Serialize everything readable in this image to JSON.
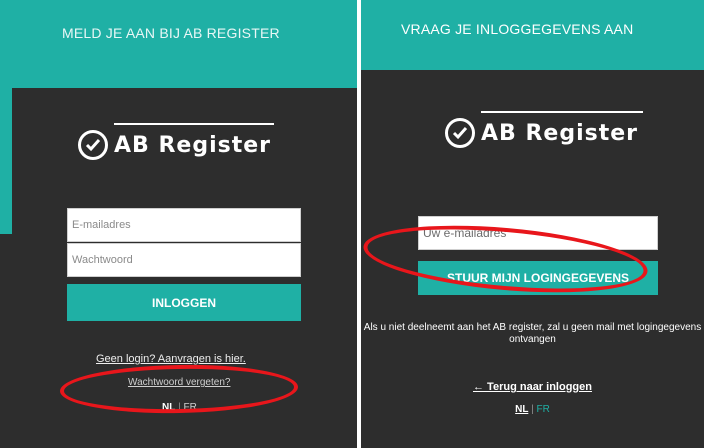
{
  "left_panel": {
    "header": "MELD JE AAN BIJ AB REGISTER",
    "logo_text": "AB Register",
    "email_placeholder": "E-mailadres",
    "password_placeholder": "Wachtwoord",
    "login_button": "INLOGGEN",
    "no_login_text": "Geen login? Aanvragen is hier.",
    "forgot_link": "Wachtwoord vergeten?",
    "lang_nl": "NL",
    "lang_sep": "|",
    "lang_fr": "FR"
  },
  "right_panel": {
    "header": "VRAAG JE INLOGGEGEVENS AAN",
    "logo_text": "AB Register",
    "email_placeholder": "Uw e-mailadres",
    "send_button": "STUUR MIJN LOGINGEGEVENS",
    "info_text": "Als u niet deelneemt aan het AB register, zal u geen mail met logingegevens ontvangen",
    "back_link": "← Terug naar inloggen",
    "lang_nl": "NL",
    "lang_sep": "|",
    "lang_fr": "FR"
  },
  "colors": {
    "accent": "#1fb0a5",
    "panel": "#2d2d2d",
    "highlight": "#e8161b"
  }
}
